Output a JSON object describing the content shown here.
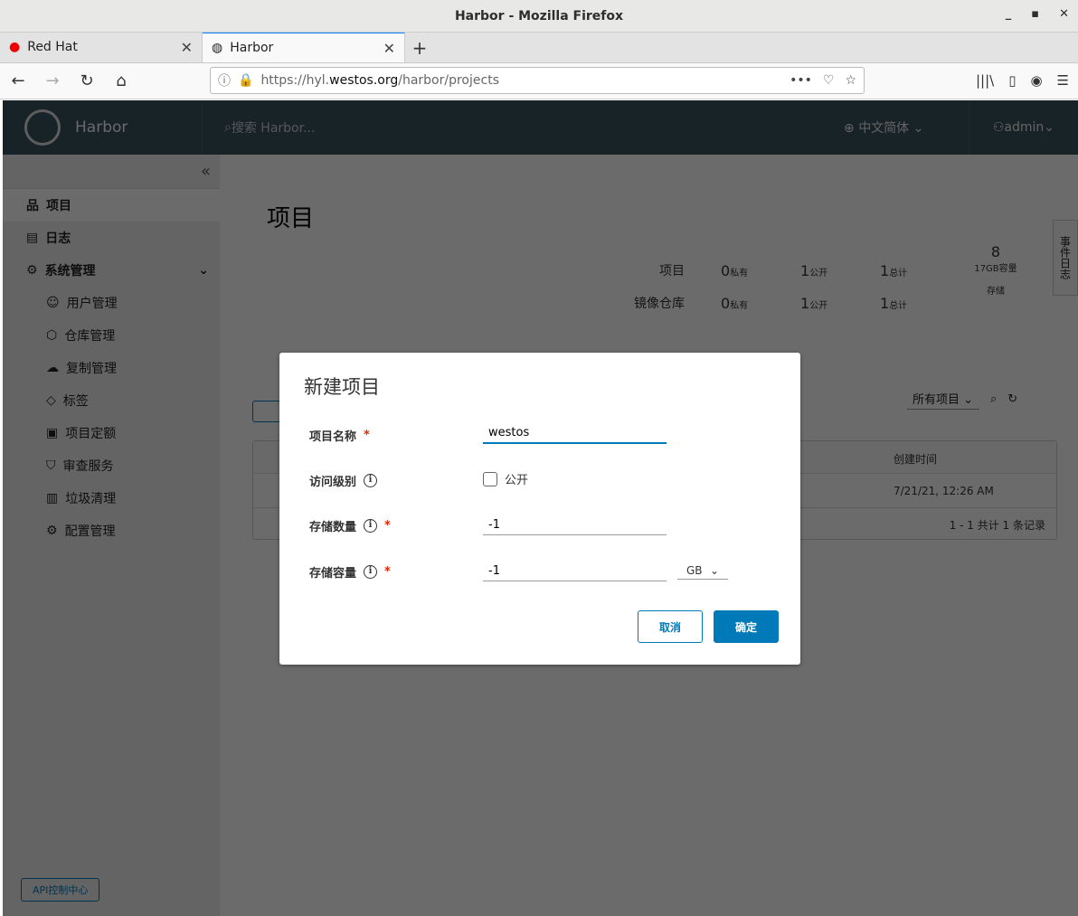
{
  "window": {
    "title": "Harbor - Mozilla Firefox"
  },
  "tabs": [
    {
      "label": "Red Hat"
    },
    {
      "label": "Harbor"
    }
  ],
  "url": {
    "prefix": "https://hyl.",
    "domain": "westos.org",
    "path": "/harbor/projects"
  },
  "header": {
    "brand": "Harbor",
    "search_placeholder": "搜索 Harbor...",
    "language": "中文简体",
    "user": "admin"
  },
  "sidebar": {
    "items": [
      {
        "label": "项目"
      },
      {
        "label": "日志"
      },
      {
        "label": "系统管理"
      }
    ],
    "sub": [
      {
        "label": "用户管理"
      },
      {
        "label": "仓库管理"
      },
      {
        "label": "复制管理"
      },
      {
        "label": "标签"
      },
      {
        "label": "项目定额"
      },
      {
        "label": "审查服务"
      },
      {
        "label": "垃圾清理"
      },
      {
        "label": "配置管理"
      }
    ],
    "api": "API控制中心"
  },
  "main": {
    "title": "项目",
    "stats": [
      {
        "label": "项目",
        "private": "0",
        "public": "1",
        "total": "1"
      },
      {
        "label": "镜像仓库",
        "private": "0",
        "public": "1",
        "total": "1"
      }
    ],
    "stat_labels": {
      "private": "私有",
      "public": "公开",
      "total": "总计"
    },
    "storage": {
      "value": "8",
      "capacity": "17GB容量",
      "label": "存储"
    },
    "filter": "所有项目",
    "table": {
      "col_created": "创建时间",
      "rows": [
        {
          "created": "7/21/21, 12:26 AM"
        }
      ],
      "footer": "1 - 1 共计 1 条记录"
    },
    "side_tab": "事件日志"
  },
  "modal": {
    "title": "新建项目",
    "name_label": "项目名称",
    "name_value": "westos",
    "access_label": "访问级别",
    "public_label": "公开",
    "public_checked": false,
    "count_label": "存储数量",
    "count_value": "-1",
    "capacity_label": "存储容量",
    "capacity_value": "-1",
    "unit": "GB",
    "cancel": "取消",
    "ok": "确定"
  },
  "colors": {
    "primary": "#0079b8",
    "required": "#e62700"
  }
}
